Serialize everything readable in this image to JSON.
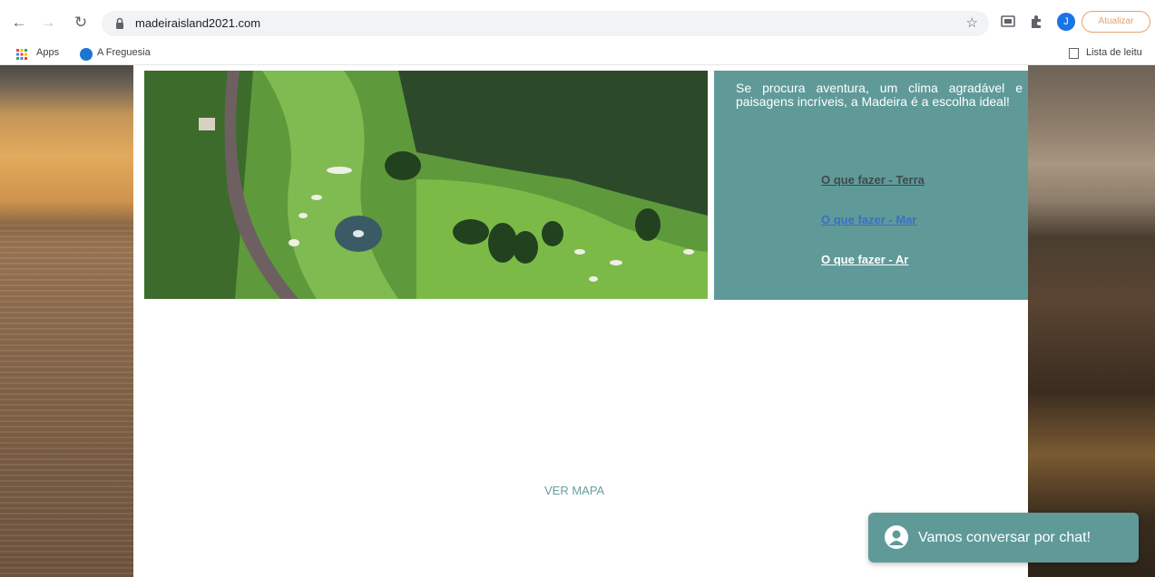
{
  "browser": {
    "url": "madeiraisland2021.com",
    "update_label": "Atualizar",
    "avatar_letter": "J",
    "bookmarks": {
      "apps": "Apps",
      "freguesia": "A Freguesia",
      "reading_list": "Lista de leitu"
    },
    "icons": {
      "back": "back-arrow-icon",
      "forward": "forward-arrow-icon",
      "reload": "reload-icon",
      "lock": "lock-icon",
      "star": "star-icon",
      "cast": "cast-icon",
      "extensions": "puzzle-icon"
    }
  },
  "panel": {
    "intro": "Se procura aventura, um clima agradável e paisagens incríveis, a Madeira é a escolha ideal!",
    "links": {
      "terra": "O que fazer - Terra",
      "mar": "O que fazer - Mar",
      "ar": "O que fazer - Ar"
    }
  },
  "map_link": "VER MAPA",
  "chat": {
    "label": "Vamos conversar por chat!",
    "icon": "user-icon"
  },
  "colors": {
    "teal": "#5f9a99",
    "chrome_bg": "#ffffff",
    "omnibox_bg": "#f1f3f4"
  }
}
